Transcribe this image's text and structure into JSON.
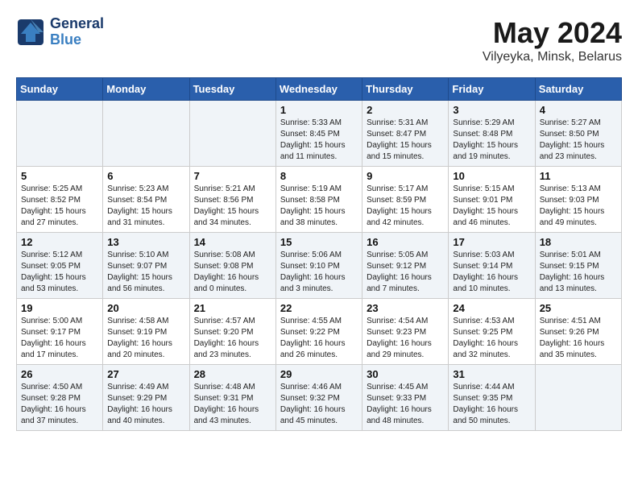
{
  "header": {
    "logo_line1": "General",
    "logo_line2": "Blue",
    "month_year": "May 2024",
    "location": "Vilyeyka, Minsk, Belarus"
  },
  "weekdays": [
    "Sunday",
    "Monday",
    "Tuesday",
    "Wednesday",
    "Thursday",
    "Friday",
    "Saturday"
  ],
  "rows": [
    [
      {
        "day": "",
        "text": ""
      },
      {
        "day": "",
        "text": ""
      },
      {
        "day": "",
        "text": ""
      },
      {
        "day": "1",
        "text": "Sunrise: 5:33 AM\nSunset: 8:45 PM\nDaylight: 15 hours\nand 11 minutes."
      },
      {
        "day": "2",
        "text": "Sunrise: 5:31 AM\nSunset: 8:47 PM\nDaylight: 15 hours\nand 15 minutes."
      },
      {
        "day": "3",
        "text": "Sunrise: 5:29 AM\nSunset: 8:48 PM\nDaylight: 15 hours\nand 19 minutes."
      },
      {
        "day": "4",
        "text": "Sunrise: 5:27 AM\nSunset: 8:50 PM\nDaylight: 15 hours\nand 23 minutes."
      }
    ],
    [
      {
        "day": "5",
        "text": "Sunrise: 5:25 AM\nSunset: 8:52 PM\nDaylight: 15 hours\nand 27 minutes."
      },
      {
        "day": "6",
        "text": "Sunrise: 5:23 AM\nSunset: 8:54 PM\nDaylight: 15 hours\nand 31 minutes."
      },
      {
        "day": "7",
        "text": "Sunrise: 5:21 AM\nSunset: 8:56 PM\nDaylight: 15 hours\nand 34 minutes."
      },
      {
        "day": "8",
        "text": "Sunrise: 5:19 AM\nSunset: 8:58 PM\nDaylight: 15 hours\nand 38 minutes."
      },
      {
        "day": "9",
        "text": "Sunrise: 5:17 AM\nSunset: 8:59 PM\nDaylight: 15 hours\nand 42 minutes."
      },
      {
        "day": "10",
        "text": "Sunrise: 5:15 AM\nSunset: 9:01 PM\nDaylight: 15 hours\nand 46 minutes."
      },
      {
        "day": "11",
        "text": "Sunrise: 5:13 AM\nSunset: 9:03 PM\nDaylight: 15 hours\nand 49 minutes."
      }
    ],
    [
      {
        "day": "12",
        "text": "Sunrise: 5:12 AM\nSunset: 9:05 PM\nDaylight: 15 hours\nand 53 minutes."
      },
      {
        "day": "13",
        "text": "Sunrise: 5:10 AM\nSunset: 9:07 PM\nDaylight: 15 hours\nand 56 minutes."
      },
      {
        "day": "14",
        "text": "Sunrise: 5:08 AM\nSunset: 9:08 PM\nDaylight: 16 hours\nand 0 minutes."
      },
      {
        "day": "15",
        "text": "Sunrise: 5:06 AM\nSunset: 9:10 PM\nDaylight: 16 hours\nand 3 minutes."
      },
      {
        "day": "16",
        "text": "Sunrise: 5:05 AM\nSunset: 9:12 PM\nDaylight: 16 hours\nand 7 minutes."
      },
      {
        "day": "17",
        "text": "Sunrise: 5:03 AM\nSunset: 9:14 PM\nDaylight: 16 hours\nand 10 minutes."
      },
      {
        "day": "18",
        "text": "Sunrise: 5:01 AM\nSunset: 9:15 PM\nDaylight: 16 hours\nand 13 minutes."
      }
    ],
    [
      {
        "day": "19",
        "text": "Sunrise: 5:00 AM\nSunset: 9:17 PM\nDaylight: 16 hours\nand 17 minutes."
      },
      {
        "day": "20",
        "text": "Sunrise: 4:58 AM\nSunset: 9:19 PM\nDaylight: 16 hours\nand 20 minutes."
      },
      {
        "day": "21",
        "text": "Sunrise: 4:57 AM\nSunset: 9:20 PM\nDaylight: 16 hours\nand 23 minutes."
      },
      {
        "day": "22",
        "text": "Sunrise: 4:55 AM\nSunset: 9:22 PM\nDaylight: 16 hours\nand 26 minutes."
      },
      {
        "day": "23",
        "text": "Sunrise: 4:54 AM\nSunset: 9:23 PM\nDaylight: 16 hours\nand 29 minutes."
      },
      {
        "day": "24",
        "text": "Sunrise: 4:53 AM\nSunset: 9:25 PM\nDaylight: 16 hours\nand 32 minutes."
      },
      {
        "day": "25",
        "text": "Sunrise: 4:51 AM\nSunset: 9:26 PM\nDaylight: 16 hours\nand 35 minutes."
      }
    ],
    [
      {
        "day": "26",
        "text": "Sunrise: 4:50 AM\nSunset: 9:28 PM\nDaylight: 16 hours\nand 37 minutes."
      },
      {
        "day": "27",
        "text": "Sunrise: 4:49 AM\nSunset: 9:29 PM\nDaylight: 16 hours\nand 40 minutes."
      },
      {
        "day": "28",
        "text": "Sunrise: 4:48 AM\nSunset: 9:31 PM\nDaylight: 16 hours\nand 43 minutes."
      },
      {
        "day": "29",
        "text": "Sunrise: 4:46 AM\nSunset: 9:32 PM\nDaylight: 16 hours\nand 45 minutes."
      },
      {
        "day": "30",
        "text": "Sunrise: 4:45 AM\nSunset: 9:33 PM\nDaylight: 16 hours\nand 48 minutes."
      },
      {
        "day": "31",
        "text": "Sunrise: 4:44 AM\nSunset: 9:35 PM\nDaylight: 16 hours\nand 50 minutes."
      },
      {
        "day": "",
        "text": ""
      }
    ]
  ],
  "alt_rows": [
    0,
    2,
    4
  ]
}
